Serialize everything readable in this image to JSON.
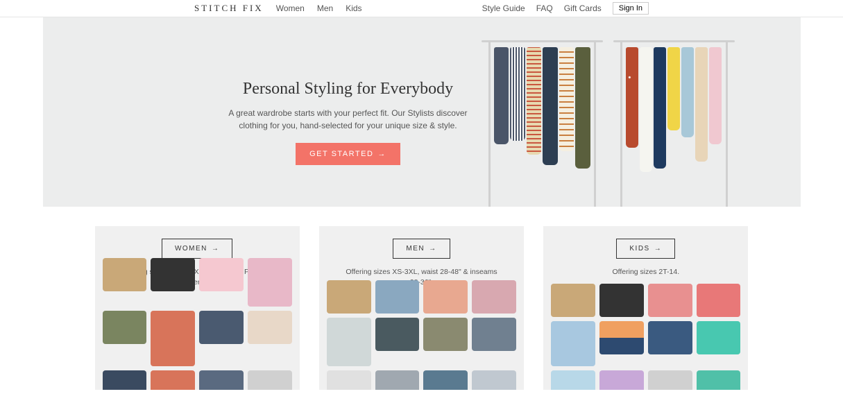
{
  "header": {
    "logo": "STITCH FIX",
    "nav": [
      "Women",
      "Men",
      "Kids"
    ],
    "links": [
      "Style Guide",
      "FAQ",
      "Gift Cards"
    ],
    "signin": "Sign In"
  },
  "hero": {
    "title": "Personal Styling for Everybody",
    "desc": "A great wardrobe starts with your perfect fit. Our Stylists discover clothing for you, hand-selected for your unique size & style.",
    "cta": "GET STARTED"
  },
  "cards": [
    {
      "label": "WOMEN",
      "desc": "Offering sizes 0-24W (XS-3X), Petite, Plus and Maternity."
    },
    {
      "label": "MEN",
      "desc": "Offering sizes XS-3XL, waist 28-48\" & inseams 28-36\"."
    },
    {
      "label": "KIDS",
      "desc": "Offering sizes 2T-14."
    }
  ],
  "colors": {
    "accent": "#f37368"
  }
}
